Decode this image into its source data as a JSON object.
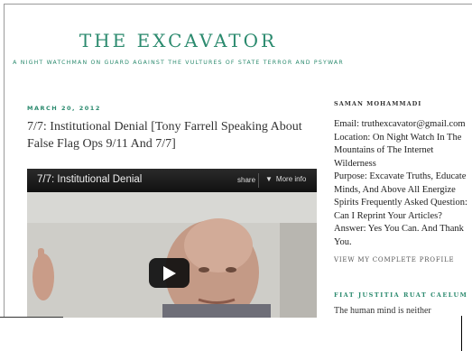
{
  "site": {
    "title": "THE EXCAVATOR",
    "description": "A NIGHT WATCHMAN ON GUARD AGAINST THE VULTURES OF STATE TERROR AND PSYWAR"
  },
  "post": {
    "date": "MARCH 20, 2012",
    "title": "7/7: Institutional Denial [Tony Farrell Speaking About False Flag Ops 9/11 And 7/7]"
  },
  "video": {
    "title": "7/7: Institutional Denial",
    "share_label": "share",
    "more_info_label": "More info"
  },
  "sidebar": {
    "profile_title": "SAMAN MOHAMMADI",
    "profile_lines": [
      "Email: truthexcavator@gmail.com",
      "Location: On Night Watch In The",
      "Mountains of The Internet",
      "Wilderness",
      "Purpose: Excavate Truths, Educate",
      "Minds, And Above All Energize",
      "Spirits Frequently Asked Question:",
      "Can I Reprint Your Articles?",
      "Answer: Yes You Can. And Thank",
      "You."
    ],
    "profile_link": "VIEW MY COMPLETE PROFILE",
    "widget2_title": "FIAT JUSTITIA RUAT CAELUM",
    "widget2_text": "The human mind is neither"
  },
  "colors": {
    "accent": "#2b8a6e",
    "text": "#333333"
  }
}
